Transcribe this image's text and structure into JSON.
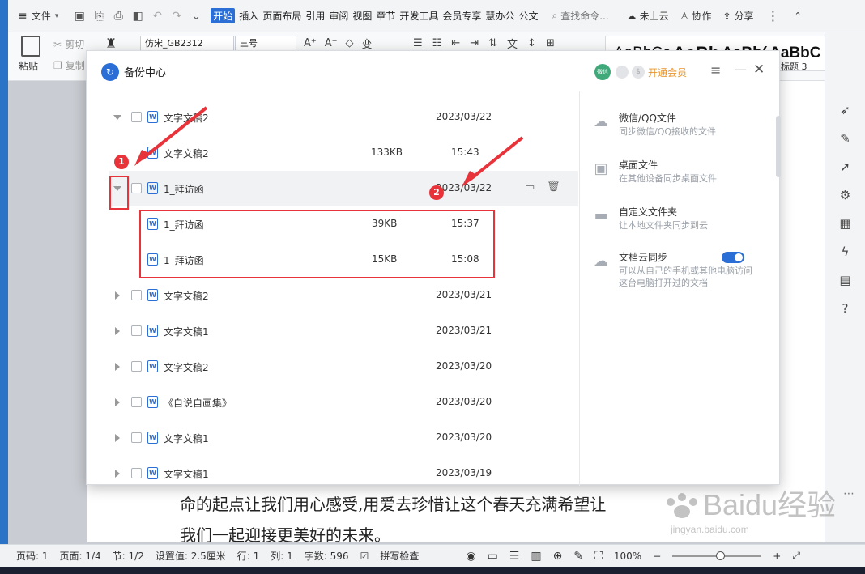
{
  "menu": {
    "file": "文件",
    "tabs": [
      "开始",
      "插入",
      "页面布局",
      "引用",
      "审阅",
      "视图",
      "章节",
      "开发工具",
      "会员专享",
      "慧办公",
      "公文"
    ],
    "active_tab": "开始",
    "search_placeholder": "查找命令...",
    "cloud": "未上云",
    "collab": "协作",
    "share": "分享"
  },
  "ribbon": {
    "paste": "粘贴",
    "cut": "剪切",
    "copy": "复制",
    "font_name": "仿宋_GB2312",
    "font_size": "三号",
    "style_previews": [
      "AaBbCc",
      "AaBb",
      "AaBb(",
      "AaBbC"
    ],
    "style_label": "标题 3"
  },
  "dialog": {
    "title": "备份中心",
    "vip": "开通会员",
    "avatar": "微信"
  },
  "file_list": [
    {
      "name": "文字文稿2",
      "size": "",
      "time": "2023/03/22",
      "expanded": true,
      "child": false
    },
    {
      "name": "文字文稿2",
      "size": "133KB",
      "time": "15:43",
      "expanded": false,
      "child": true
    },
    {
      "name": "1_拜访函",
      "size": "",
      "time": "2023/03/22",
      "expanded": true,
      "child": false,
      "selected": true
    },
    {
      "name": "1_拜访函",
      "size": "39KB",
      "time": "15:37",
      "expanded": false,
      "child": true
    },
    {
      "name": "1_拜访函",
      "size": "15KB",
      "time": "15:08",
      "expanded": false,
      "child": true
    },
    {
      "name": "文字文稿2",
      "size": "",
      "time": "2023/03/21",
      "expanded": false,
      "child": false
    },
    {
      "name": "文字文稿1",
      "size": "",
      "time": "2023/03/21",
      "expanded": false,
      "child": false
    },
    {
      "name": "文字文稿2",
      "size": "",
      "time": "2023/03/20",
      "expanded": false,
      "child": false
    },
    {
      "name": "《自说自画集》",
      "size": "",
      "time": "2023/03/20",
      "expanded": false,
      "child": false
    },
    {
      "name": "文字文稿1",
      "size": "",
      "time": "2023/03/20",
      "expanded": false,
      "child": false
    },
    {
      "name": "文字文稿1",
      "size": "",
      "time": "2023/03/19",
      "expanded": false,
      "child": false
    }
  ],
  "side_items": [
    {
      "title": "微信/QQ文件",
      "desc": "同步微信/QQ接收的文件"
    },
    {
      "title": "桌面文件",
      "desc": "在其他设备同步桌面文件"
    },
    {
      "title": "自定义文件夹",
      "desc": "让本地文件夹同步到云"
    },
    {
      "title": "文档云同步",
      "desc": "可以从自己的手机或其他电脑访问这台电脑打开过的文档"
    }
  ],
  "sync_toggle": "on",
  "annotations": [
    "1",
    "2"
  ],
  "document": {
    "line1": "命的起点让我们用心感受,用爱去珍惜让这个春天充满希望让",
    "line2": "我们一起迎接更美好的未来。"
  },
  "status": {
    "page_no": "页码: 1",
    "pages": "页面: 1/4",
    "section": "节: 1/2",
    "setting": "设置值: 2.5厘米",
    "row": "行: 1",
    "col": "列: 1",
    "words": "字数: 596",
    "spell": "拼写检查",
    "zoom": "100%"
  },
  "watermark": {
    "brand": "Baidu经验",
    "url": "jingyan.baidu.com"
  }
}
